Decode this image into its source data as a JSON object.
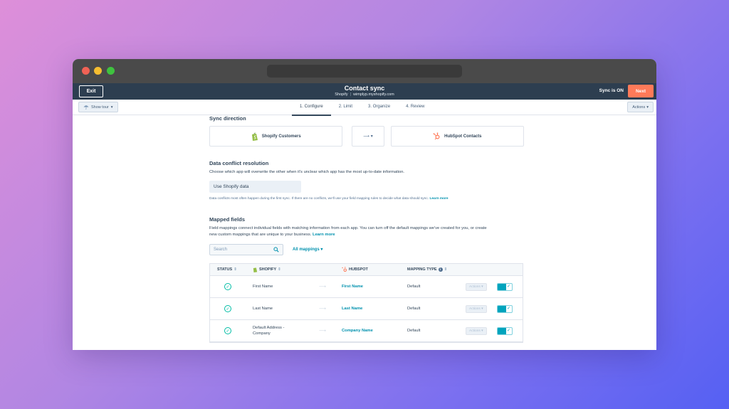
{
  "header": {
    "exit_label": "Exit",
    "title": "Contact sync",
    "source_app": "Shopify",
    "shop_url": "wimplyp.myshopify.com",
    "sync_status": "Sync is ON",
    "next_label": "Next"
  },
  "toolbar": {
    "tour_label": "Show tour",
    "actions_label": "Actions",
    "tabs": [
      {
        "label": "1. Configure",
        "active": true
      },
      {
        "label": "2. Limit",
        "active": false
      },
      {
        "label": "3. Organize",
        "active": false
      },
      {
        "label": "4. Review",
        "active": false
      }
    ]
  },
  "sync_direction": {
    "title": "Sync direction",
    "left_app": "Shopify Customers",
    "direction_symbol": "⟶",
    "right_app": "HubSpot Contacts"
  },
  "conflict": {
    "title": "Data conflict resolution",
    "description": "Choose which app will overwrite the other when it's unclear which app has the most up-to-date information.",
    "selected": "Use Shopify data",
    "note": "Data conflicts most often happen during the first sync. If there are no conflicts, we'll use your field mapping rules to decide what data should sync.",
    "note_link": "Learn more"
  },
  "mapped_fields": {
    "title": "Mapped fields",
    "description_1": "Field mappings connect individual fields with matching information from each app. You can turn off the default mappings we've created for you, or create",
    "description_2": "new custom mappings that are unique to your business.",
    "learn_more": "Learn more",
    "search_placeholder": "Search",
    "filter_label": "All mappings",
    "columns": {
      "status": "STATUS",
      "shopify": "SHOPIFY",
      "hubspot": "HUBSPOT",
      "mapping_type": "MAPPING TYPE"
    },
    "rows": [
      {
        "shopify": "First Name",
        "hubspot": "First Name",
        "type": "Default",
        "actions": "Actions"
      },
      {
        "shopify": "Last Name",
        "hubspot": "Last Name",
        "type": "Default",
        "actions": "Actions"
      },
      {
        "shopify": "Default Address - Company",
        "hubspot": "Company Name",
        "type": "Default",
        "actions": "Actions"
      }
    ]
  },
  "colors": {
    "header_bg": "#2d3e50",
    "accent_orange": "#ff7a59",
    "link_teal": "#0091ae",
    "success_green": "#00bda5",
    "shopify_green": "#95bf47",
    "hubspot_orange": "#ff7a59"
  }
}
